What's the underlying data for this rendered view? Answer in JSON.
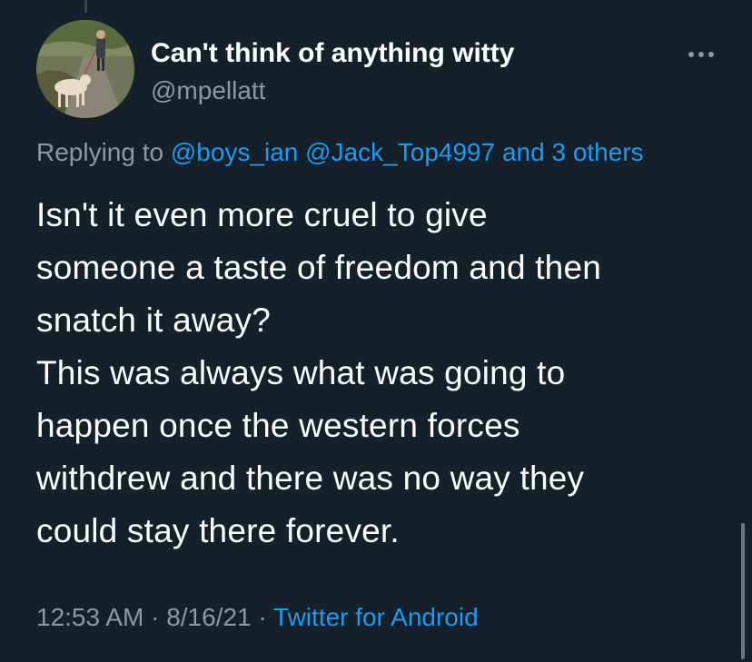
{
  "author": {
    "display_name": "Can't think of anything witty",
    "handle": "@mpellatt"
  },
  "reply": {
    "prefix": "Replying to",
    "mentions": [
      "@boys_ian",
      "@Jack_Top4997"
    ],
    "connector": "and",
    "others": "3 others"
  },
  "tweet": {
    "text": "Isn't it even more cruel to give\nsomeone a taste of freedom and then\nsnatch it away?\nThis was always what was going to\nhappen once the western forces\nwithdrew and there was no way they\ncould stay there forever."
  },
  "meta": {
    "time": "12:53 AM",
    "separator": "·",
    "date": "8/16/21",
    "source": "Twitter for Android"
  },
  "icons": {
    "more": "more-horizontal-icon"
  },
  "colors": {
    "background": "#15202b",
    "link": "#1d9bf0",
    "secondary_text": "#8b98a5",
    "primary_text": "#ffffff"
  }
}
